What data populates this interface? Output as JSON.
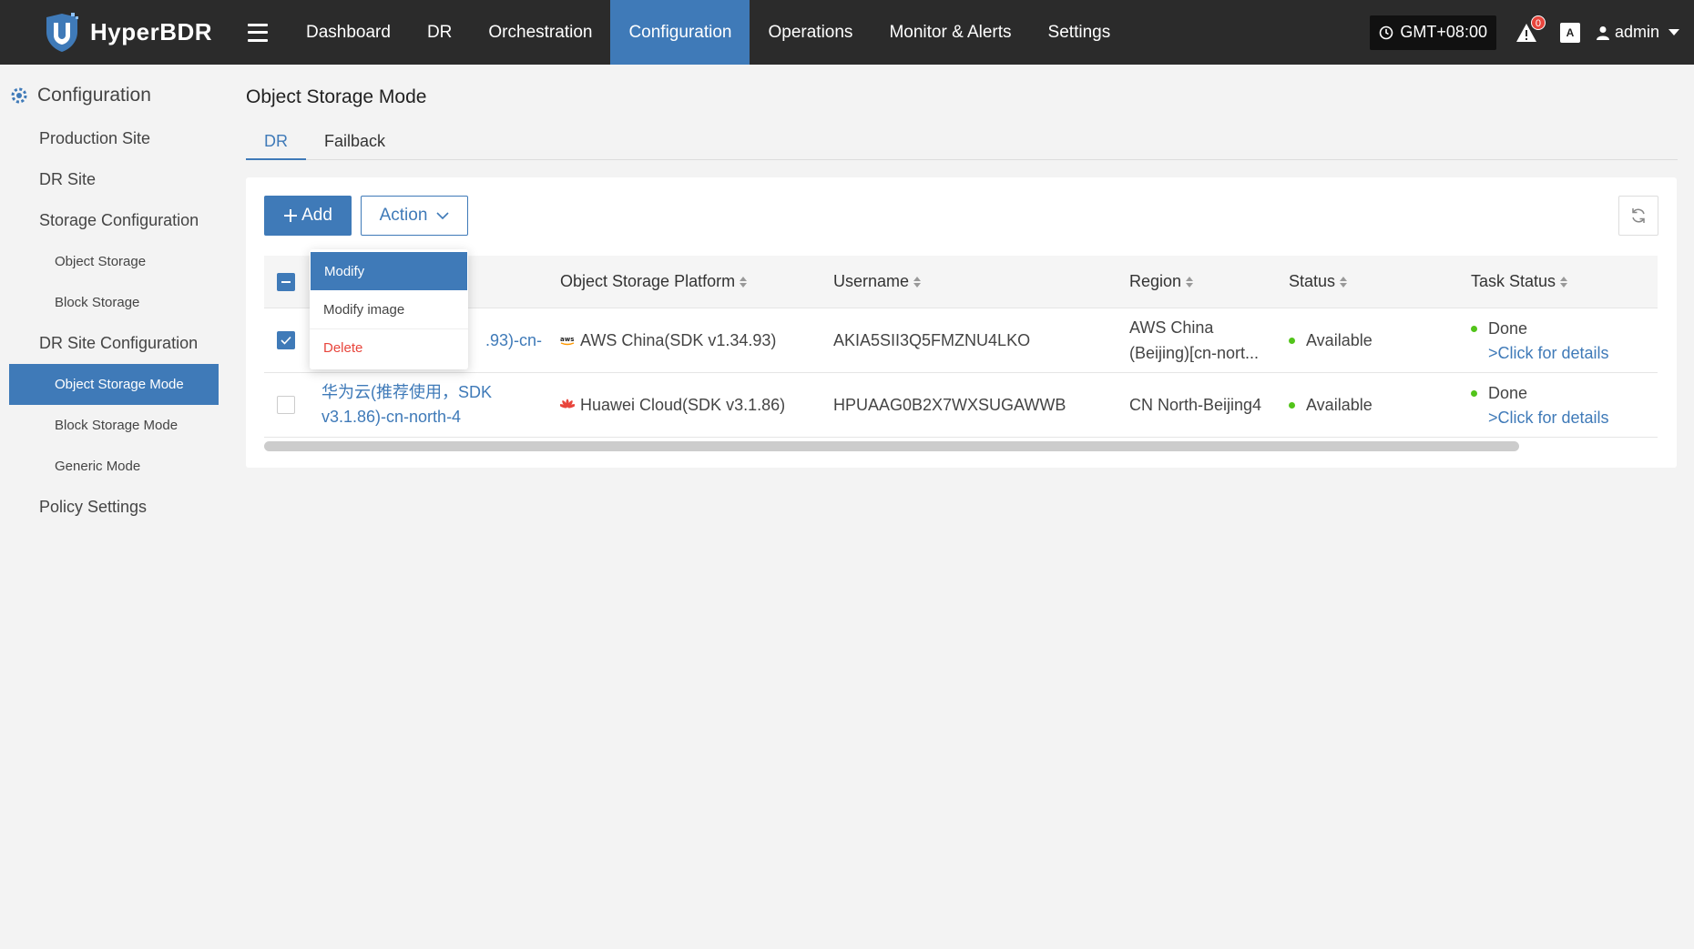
{
  "app": {
    "name": "HyperBDR"
  },
  "nav": {
    "items": [
      {
        "label": "Dashboard",
        "active": false
      },
      {
        "label": "DR",
        "active": false
      },
      {
        "label": "Orchestration",
        "active": false
      },
      {
        "label": "Configuration",
        "active": true
      },
      {
        "label": "Operations",
        "active": false
      },
      {
        "label": "Monitor & Alerts",
        "active": false
      },
      {
        "label": "Settings",
        "active": false
      }
    ],
    "timezone": "GMT+08:00",
    "alert_count": "0",
    "lang_icon": "A",
    "user": "admin"
  },
  "sidebar": {
    "header": "Configuration",
    "items": [
      {
        "label": "Production Site"
      },
      {
        "label": "DR Site"
      },
      {
        "label": "Storage Configuration"
      },
      {
        "label": "Object Storage"
      },
      {
        "label": "Block Storage"
      },
      {
        "label": "DR Site Configuration"
      },
      {
        "label": "Object Storage Mode"
      },
      {
        "label": "Block Storage Mode"
      },
      {
        "label": "Generic Mode"
      },
      {
        "label": "Policy Settings"
      }
    ]
  },
  "page": {
    "title": "Object Storage Mode",
    "tabs": [
      "DR",
      "Failback"
    ],
    "add_label": "Add",
    "action_label": "Action"
  },
  "dropdown": {
    "items": [
      "Modify",
      "Modify image",
      "Delete"
    ]
  },
  "table": {
    "headers": [
      "Object Storage Platform",
      "Username",
      "Region",
      "Status",
      "Task Status"
    ],
    "rows": [
      {
        "name_line1": ".93)-cn-",
        "name_line2": "",
        "platform": "AWS China(SDK v1.34.93)",
        "username": "AKIA5SII3Q5FMZNU4LKO",
        "region_line1": "AWS China",
        "region_line2": "(Beijing)[cn-nort...",
        "status": "Available",
        "task_status": "Done",
        "task_link": ">Click for details",
        "checked": true
      },
      {
        "name_line1": "华为云(推荐使用，SDK",
        "name_line2": "v3.1.86)-cn-north-4",
        "platform": "Huawei Cloud(SDK v3.1.86)",
        "username": "HPUAAG0B2X7WXSUGAWWB",
        "region_line1": "CN North-Beijing4",
        "region_line2": "",
        "status": "Available",
        "task_status": "Done",
        "task_link": ">Click for details",
        "checked": false
      }
    ]
  },
  "colors": {
    "accent": "#3f7ab8",
    "topbar": "#2b2b2b",
    "success": "#52c41a",
    "danger": "#e8453c"
  }
}
